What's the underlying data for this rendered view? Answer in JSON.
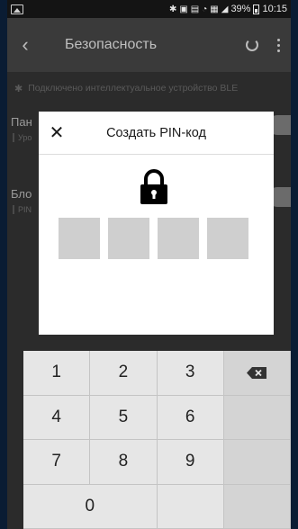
{
  "status_bar": {
    "battery_percent": "39%",
    "time": "10:15",
    "icons": [
      "bluetooth-icon",
      "nfc-icon",
      "hd-icon",
      "wifi-icon",
      "data-icon",
      "signal-icon",
      "battery-icon"
    ]
  },
  "app_bar": {
    "title": "Безопасность",
    "icons": [
      "back-arrow-icon",
      "refresh-icon",
      "more-vert-icon"
    ]
  },
  "banner": {
    "icon": "asterisk-icon",
    "text": "Подключено интеллектуальное устройство BLE"
  },
  "settings": {
    "row1": {
      "title": "Пан",
      "subtitle": "Уро"
    },
    "row2": {
      "title": "Бло",
      "subtitle": "PIN"
    }
  },
  "dialog": {
    "title": "Создать PIN-код",
    "close_icon": "close-icon",
    "lock_icon": "lock-icon",
    "pin_length": 4
  },
  "keypad": {
    "keys": [
      "1",
      "2",
      "3",
      "4",
      "5",
      "6",
      "7",
      "8",
      "9",
      "0"
    ],
    "backspace_icon": "backspace-icon"
  },
  "colors": {
    "background": "#0a1c33",
    "screen_dim": "#2b2b2b",
    "dialog": "#ffffff",
    "pin_box": "#cfcfcf",
    "key": "#e6e6e6"
  }
}
